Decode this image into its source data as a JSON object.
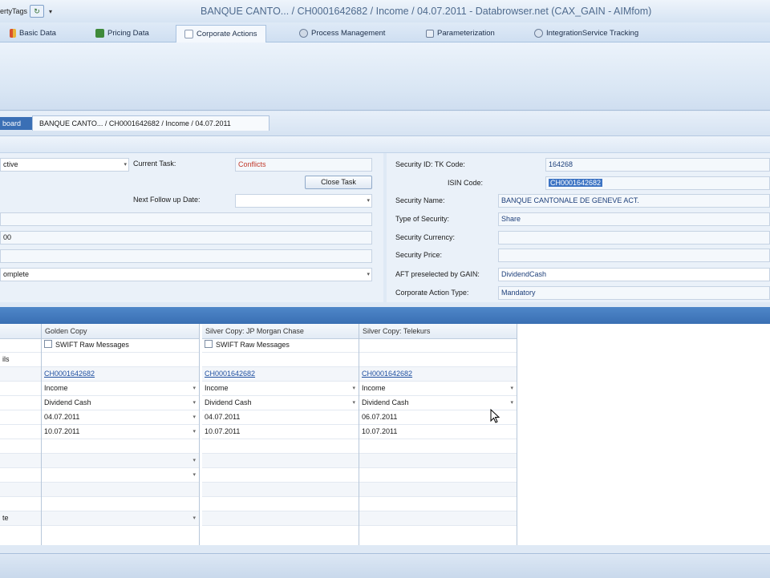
{
  "titlebar": {
    "qat_text": "ertyTags",
    "title": "BANQUE CANTO... / CH0001642682 / Income / 04.07.2011 - Databrowser.net (CAX_GAIN - AIMfom)"
  },
  "tabs": [
    {
      "label": "Basic Data"
    },
    {
      "label": "Pricing Data"
    },
    {
      "label": "Corporate Actions"
    },
    {
      "label": "Process Management"
    },
    {
      "label": "Parameterization"
    },
    {
      "label": "IntegrationService Tracking"
    }
  ],
  "breadcrumb": {
    "dashboard_label": "board",
    "document_tab": "BANQUE CANTO... / CH0001642682 / Income / 04.07.2011"
  },
  "left_form": {
    "status_value": "ctive",
    "current_task_label": "Current Task:",
    "current_task_value": "Conflicts",
    "close_task_button": "Close Task",
    "next_followup_label": "Next Follow up Date:",
    "next_followup_value": "",
    "field_row2": "00",
    "completion_value": "omplete"
  },
  "right_form": {
    "security_id_label": "Security ID: TK Code:",
    "security_id_value": "164268",
    "isin_label": "ISIN Code:",
    "isin_value": "CH0001642682",
    "security_name_label": "Security Name:",
    "security_name_value": "BANQUE CANTONALE DE GENEVE ACT.",
    "type_label": "Type of Security:",
    "type_value": "Share",
    "currency_label": "Security Currency:",
    "currency_value": "",
    "price_label": "Security Price:",
    "price_value": "",
    "aft_label": "AFT preselected by GAIN:",
    "aft_value": "DividendCash",
    "ca_type_label": "Corporate Action Type:",
    "ca_type_value": "Mandatory"
  },
  "grid": {
    "columns": [
      {
        "header": ""
      },
      {
        "header": "Golden Copy"
      },
      {
        "header": "Silver Copy: JP Morgan Chase"
      },
      {
        "header": "Silver Copy: Telekurs"
      }
    ],
    "row_labels": [
      "",
      "ils",
      "",
      "",
      "",
      "",
      "",
      "",
      "",
      "",
      "",
      "",
      "te"
    ],
    "golden": {
      "swift": "SWIFT Raw Messages",
      "isin": "CH0001642682",
      "event": "Income",
      "action": "Dividend Cash",
      "date1": "04.07.2011",
      "date2": "10.07.2011"
    },
    "jpm": {
      "swift": "SWIFT Raw Messages",
      "isin": "CH0001642682",
      "event": "Income",
      "action": "Dividend Cash",
      "date1": "04.07.2011",
      "date2": "10.07.2011"
    },
    "telekurs": {
      "isin": "CH0001642682",
      "event": "Income",
      "action": "Dividend Cash",
      "date1": "06.07.2011",
      "date2": "10.07.2011"
    }
  },
  "colors": {
    "accent": "#3a6fb3",
    "conflict_text": "#c0392b"
  }
}
